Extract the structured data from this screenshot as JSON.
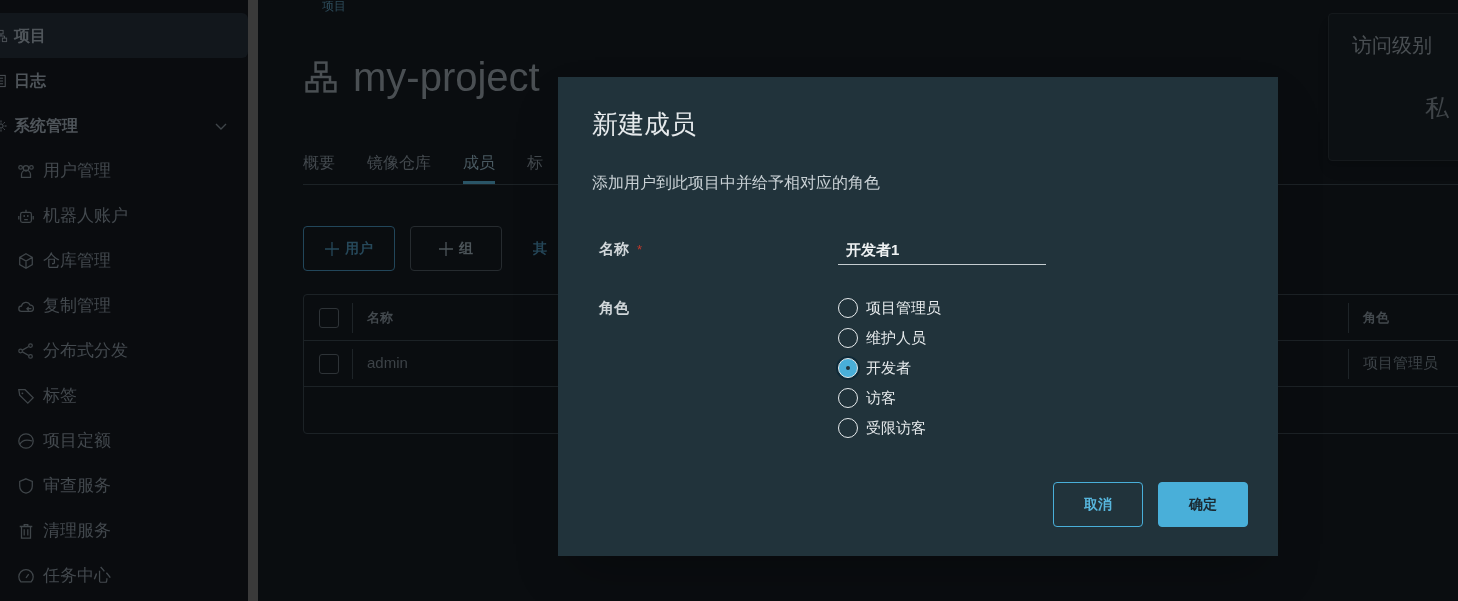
{
  "breadcrumb": "项目",
  "sidebar": {
    "items": [
      {
        "label": "项目",
        "selected": true
      },
      {
        "label": "日志",
        "selected": false
      },
      {
        "label": "系统管理",
        "selected": false,
        "expanded": true,
        "children": [
          {
            "label": "用户管理"
          },
          {
            "label": "机器人账户"
          },
          {
            "label": "仓库管理"
          },
          {
            "label": "复制管理"
          },
          {
            "label": "分布式分发"
          },
          {
            "label": "标签"
          },
          {
            "label": "项目定额"
          },
          {
            "label": "审查服务"
          },
          {
            "label": "清理服务"
          },
          {
            "label": "任务中心"
          }
        ]
      }
    ]
  },
  "project": {
    "title": "my-project"
  },
  "tabs": [
    {
      "label": "概要",
      "selected": false
    },
    {
      "label": "镜像仓库",
      "selected": false
    },
    {
      "label": "成员",
      "selected": true
    },
    {
      "label": "标",
      "selected": false
    }
  ],
  "actions": [
    {
      "label": "用户",
      "disabled": false
    },
    {
      "label": "组",
      "disabled": true
    }
  ],
  "more_action": "其",
  "table": {
    "select_all_checked": false,
    "columns": [
      "名称",
      "角色"
    ],
    "rows": [
      {
        "checked": false,
        "cells": [
          "admin",
          "项目管理员"
        ]
      }
    ]
  },
  "access_card": {
    "title": "访问级别",
    "value": "私"
  },
  "dialog": {
    "title": "新建成员",
    "description": "添加用户到此项目中并给予相对应的角色",
    "name_field": {
      "label": "名称",
      "required": true,
      "required_mark": "*",
      "value": "开发者1"
    },
    "role_label": "角色",
    "roles": [
      {
        "label": "项目管理员",
        "selected": false
      },
      {
        "label": "维护人员",
        "selected": false
      },
      {
        "label": "开发者",
        "selected": true
      },
      {
        "label": "访客",
        "selected": false
      },
      {
        "label": "受限访客",
        "selected": false
      }
    ],
    "buttons": [
      {
        "label": "取消",
        "kind": "secondary"
      },
      {
        "label": "确定",
        "kind": "primary"
      }
    ]
  }
}
